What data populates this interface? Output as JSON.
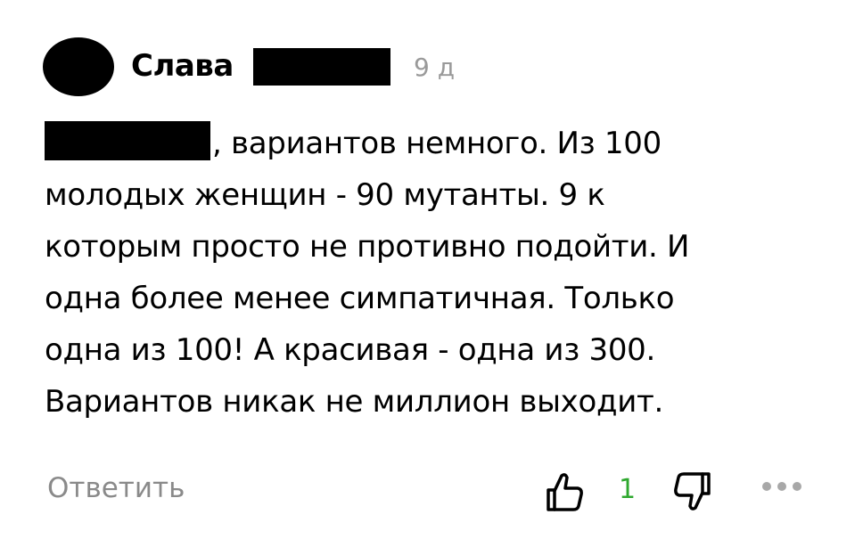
{
  "comment": {
    "author": {
      "name": "Слава"
    },
    "time": "9 д",
    "text_lines": [
      ", вариантов немного. Из 100",
      "молодых женщин - 90 мутанты. 9 к",
      "которым просто не противно подойти. И",
      "одна более менее симпатичная. Только",
      "одна из 100! А красивая - одна из 300.",
      "Вариантов никак не миллион выходит."
    ],
    "actions": {
      "reply_label": "Ответить",
      "likes": "1"
    },
    "icons": {
      "like": "thumbs-up-icon",
      "dislike": "thumbs-down-icon",
      "more": "more-horizontal-icon"
    },
    "colors": {
      "likes_count": "#2ea82e",
      "muted_text": "#8a8a8a"
    }
  }
}
